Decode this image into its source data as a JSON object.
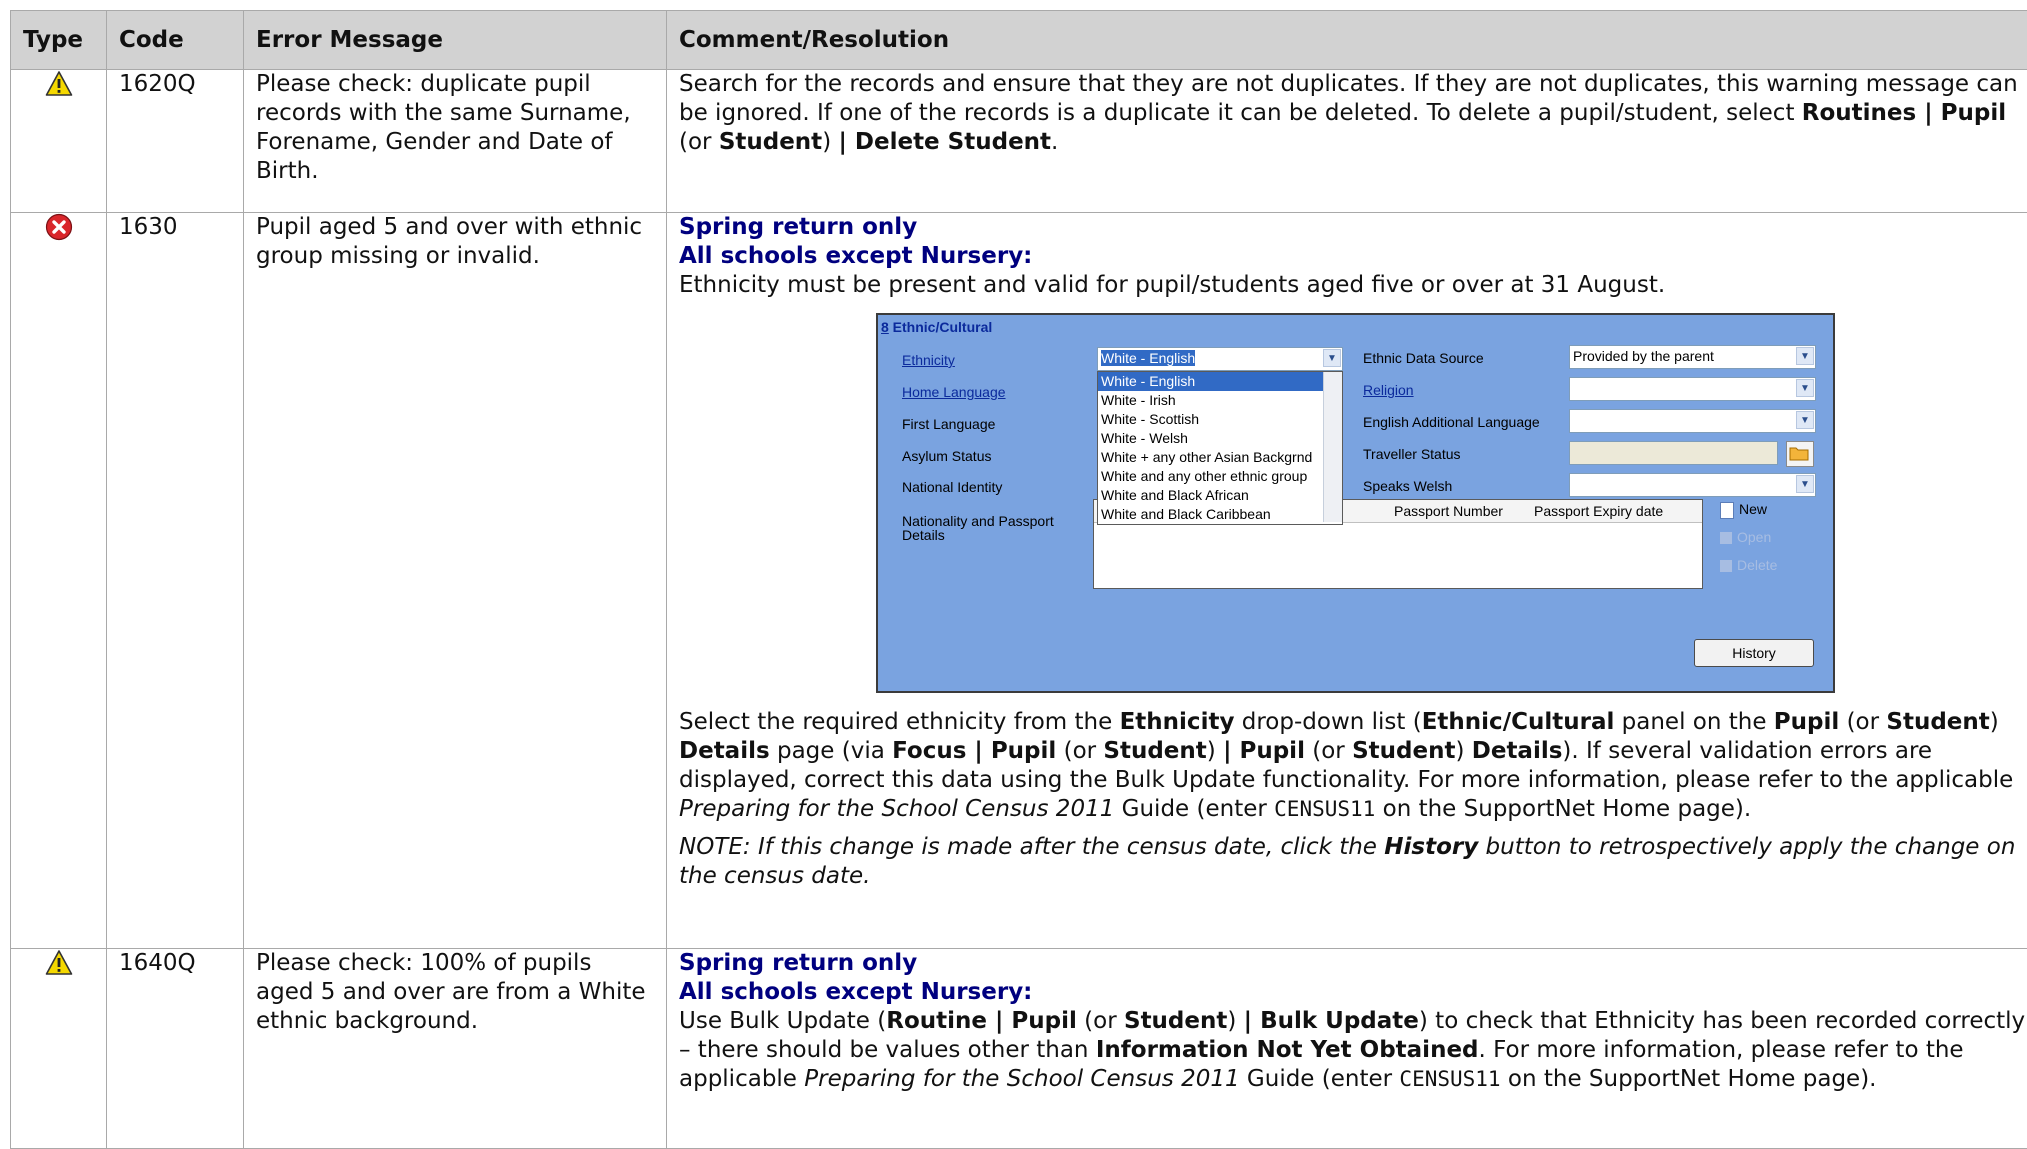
{
  "headers": {
    "type": "Type",
    "code": "Code",
    "message": "Error Message",
    "resolution": "Comment/Resolution"
  },
  "icons": {
    "warning": "warning-triangle-icon",
    "error": "error-x-icon"
  },
  "colors": {
    "heading_blue": "#00007f",
    "warning_yellow": "#f5d800",
    "error_red": "#d9262b"
  },
  "rows": [
    {
      "code": "1620Q",
      "message": "Please check: duplicate pupil records with the same Surname, Forename, Gender and Date of Birth.",
      "res_text1": "Search for the records and ensure that they are not duplicates. If they are not duplicates, this warning message can be ignored. If one of the records is a duplicate it can be deleted. To delete a pupil/student, select ",
      "res_b1": "Routines | Pupil",
      "res_t2": " (or ",
      "res_b2": "Student",
      "res_t3": ") ",
      "res_b3": "| Delete Student",
      "res_t4": "."
    },
    {
      "code": "1630",
      "message": "Pupil aged 5 and over with ethnic group missing or invalid.",
      "head1": "Spring return only",
      "head2": "All schools except Nursery:",
      "line1": "Ethnicity must be present and valid for pupil/students aged five or over at 31 August.",
      "p_a": "Select the required ethnicity from the ",
      "p_b": "Ethnicity",
      "p_c": " drop-down list (",
      "p_d": "Ethnic/Cultural",
      "p_e": " panel on the ",
      "p_f": "Pupil",
      "p_g": " (or ",
      "p_h": "Student",
      "p_i": ") ",
      "p_j": "Details",
      "p_k": " page (via ",
      "p_l": "Focus | Pupil",
      "p_m": " (or ",
      "p_n": "Student",
      "p_o": ") ",
      "p_p": "| Pupil",
      "p_q": " (or ",
      "p_r": "Student",
      "p_s": ") ",
      "p_t": "Details",
      "p_u": "). If several validation errors are displayed, correct this data using the Bulk Update functionality. For more information, please refer to the applicable ",
      "p_v": "Preparing for the School Census 2011",
      "p_w": " Guide (enter ",
      "p_x": "CENSUS11",
      "p_y": " on the SupportNet Home page).",
      "note_a": "NOTE: If this change is made after the census date, click the ",
      "note_b": "History",
      "note_c": " button to retrospectively apply the change on the census date."
    },
    {
      "code": "1640Q",
      "message": "Please check: 100% of pupils aged 5 and over are from a White ethnic background.",
      "head1": "Spring return only",
      "head2": "All schools except Nursery:",
      "q_a": "Use Bulk Update (",
      "q_b": "Routine | Pupil",
      "q_c": " (or ",
      "q_d": "Student",
      "q_e": ") ",
      "q_f": "| Bulk Update",
      "q_g": ") to check that Ethnicity has been recorded correctly – there should be values other than ",
      "q_h": "Information Not Yet Obtained",
      "q_i": ". For more information, please refer to the applicable ",
      "q_j": "Preparing for the School Census 2011",
      "q_k": " Guide (enter ",
      "q_l": "CENSUS11",
      "q_m": " on the SupportNet Home page)."
    }
  ],
  "screenshot": {
    "panel_num": "8",
    "panel_title": " Ethnic/Cultural",
    "labels": {
      "ethnicity": "Ethnicity",
      "home_language": "Home Language",
      "first_language": "First Language",
      "asylum_status": "Asylum Status",
      "national_identity": "National Identity",
      "nationality_passport": "Nationality and Passport",
      "details": "Details",
      "ethnic_data_source": "Ethnic Data Source",
      "religion": "Religion",
      "english_additional_language": "English Additional Language",
      "traveller_status": "Traveller Status",
      "speaks_welsh": "Speaks Welsh"
    },
    "ethnicity_value": "White - English",
    "ethnic_data_source_value": "Provided by the parent",
    "ethnicity_options": [
      "White - English",
      "White - Irish",
      "White - Scottish",
      "White - Welsh",
      "White + any other Asian Backgrnd",
      "White and any other ethnic group",
      "White and Black African",
      "White and Black Caribbean"
    ],
    "grid_headers": {
      "passport_number": "Passport Number",
      "passport_expiry": "Passport Expiry date"
    },
    "new_label": "New",
    "open_label": "Open",
    "delete_label": "Delete",
    "history_label": "History"
  }
}
